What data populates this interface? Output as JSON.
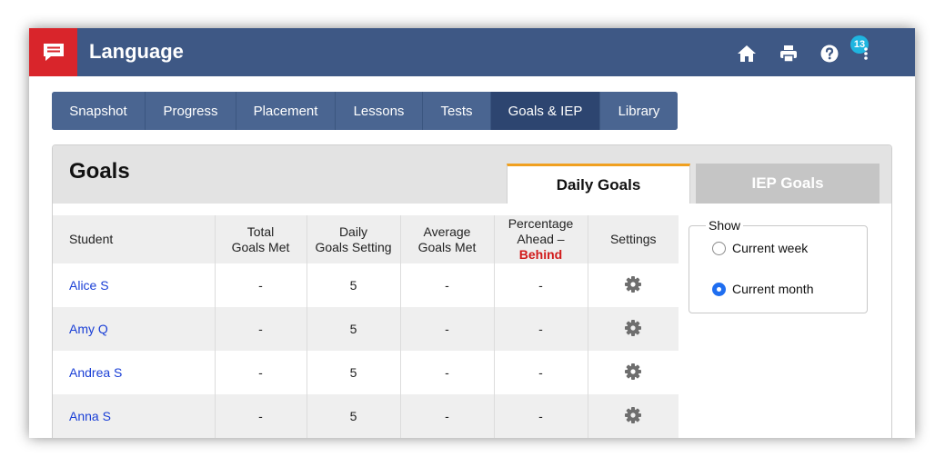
{
  "header": {
    "title": "Language",
    "logo_icon": "speech-bubble-icon",
    "icons": [
      "home-icon",
      "print-icon",
      "help-icon",
      "more-vertical-icon"
    ],
    "notification_count": "13",
    "bar_color": "#3e5885",
    "brand_color": "#d9252b"
  },
  "nav": {
    "tabs": [
      {
        "label": "Snapshot"
      },
      {
        "label": "Progress"
      },
      {
        "label": "Placement"
      },
      {
        "label": "Lessons"
      },
      {
        "label": "Tests"
      },
      {
        "label": "Goals & IEP",
        "active": true
      },
      {
        "label": "Library"
      }
    ]
  },
  "goals": {
    "title": "Goals",
    "tabs": {
      "daily": "Daily Goals",
      "iep": "IEP Goals"
    },
    "accent_color": "#f0a020",
    "columns": {
      "student": "Student",
      "total_1": "Total",
      "total_2": "Goals Met",
      "daily_1": "Daily",
      "daily_2": "Goals Setting",
      "avg_1": "Average",
      "avg_2": "Goals Met",
      "pct_1": "Percentage",
      "pct_2a": "Ahead – ",
      "pct_2b": "Behind",
      "settings": "Settings"
    },
    "rows": [
      {
        "student": "Alice S",
        "total": "-",
        "daily": "5",
        "average": "-",
        "percentage": "-"
      },
      {
        "student": "Amy Q",
        "total": "-",
        "daily": "5",
        "average": "-",
        "percentage": "-"
      },
      {
        "student": "Andrea S",
        "total": "-",
        "daily": "5",
        "average": "-",
        "percentage": "-"
      },
      {
        "student": "Anna S",
        "total": "-",
        "daily": "5",
        "average": "-",
        "percentage": "-"
      }
    ]
  },
  "show": {
    "legend": "Show",
    "options": [
      {
        "label": "Current week",
        "checked": false
      },
      {
        "label": "Current month",
        "checked": true
      }
    ]
  }
}
